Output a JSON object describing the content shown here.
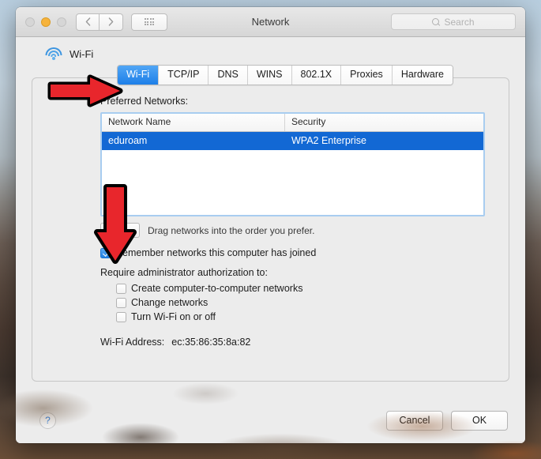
{
  "window": {
    "title": "Network",
    "traffic_lights": [
      "close",
      "minimize",
      "maximize"
    ],
    "nav_back_icon": "chevron-left-icon",
    "nav_forward_icon": "chevron-right-icon",
    "grid_icon": "grid-dots-icon"
  },
  "search": {
    "placeholder": "Search",
    "icon": "search-icon",
    "value": ""
  },
  "interface": {
    "icon": "wifi-icon",
    "label": "Wi-Fi"
  },
  "tabs": [
    {
      "label": "Wi-Fi",
      "active": true
    },
    {
      "label": "TCP/IP",
      "active": false
    },
    {
      "label": "DNS",
      "active": false
    },
    {
      "label": "WINS",
      "active": false
    },
    {
      "label": "802.1X",
      "active": false
    },
    {
      "label": "Proxies",
      "active": false
    },
    {
      "label": "Hardware",
      "active": false
    }
  ],
  "preferred_networks": {
    "label": "Preferred Networks:",
    "columns": [
      "Network Name",
      "Security"
    ],
    "rows": [
      {
        "name": "eduroam",
        "security": "WPA2 Enterprise",
        "selected": true
      }
    ]
  },
  "list_toolbar": {
    "add_label": "+",
    "remove_label": "−",
    "hint": "Drag networks into the order you prefer."
  },
  "options": {
    "remember": {
      "label": "Remember networks this computer has joined",
      "checked": true
    },
    "require_label": "Require administrator authorization to:",
    "require_items": [
      {
        "label": "Create computer-to-computer networks",
        "checked": false
      },
      {
        "label": "Change networks",
        "checked": false
      },
      {
        "label": "Turn Wi-Fi on or off",
        "checked": false
      }
    ]
  },
  "wifi_address": {
    "label": "Wi-Fi Address:",
    "value": "ec:35:86:35:8a:82"
  },
  "footer": {
    "help_label": "?",
    "cancel_label": "Cancel",
    "ok_label": "OK"
  },
  "annotations": [
    {
      "name": "arrow-right-to-wifi-tab",
      "direction": "right",
      "color": "#e8262c"
    },
    {
      "name": "arrow-down-to-remove-button",
      "direction": "down",
      "color": "#e8262c"
    }
  ],
  "colors": {
    "accent_blue": "#1d7fe8",
    "selection_blue": "#1268d4",
    "annotation_red": "#e8262c",
    "window_bg": "#ececec"
  }
}
